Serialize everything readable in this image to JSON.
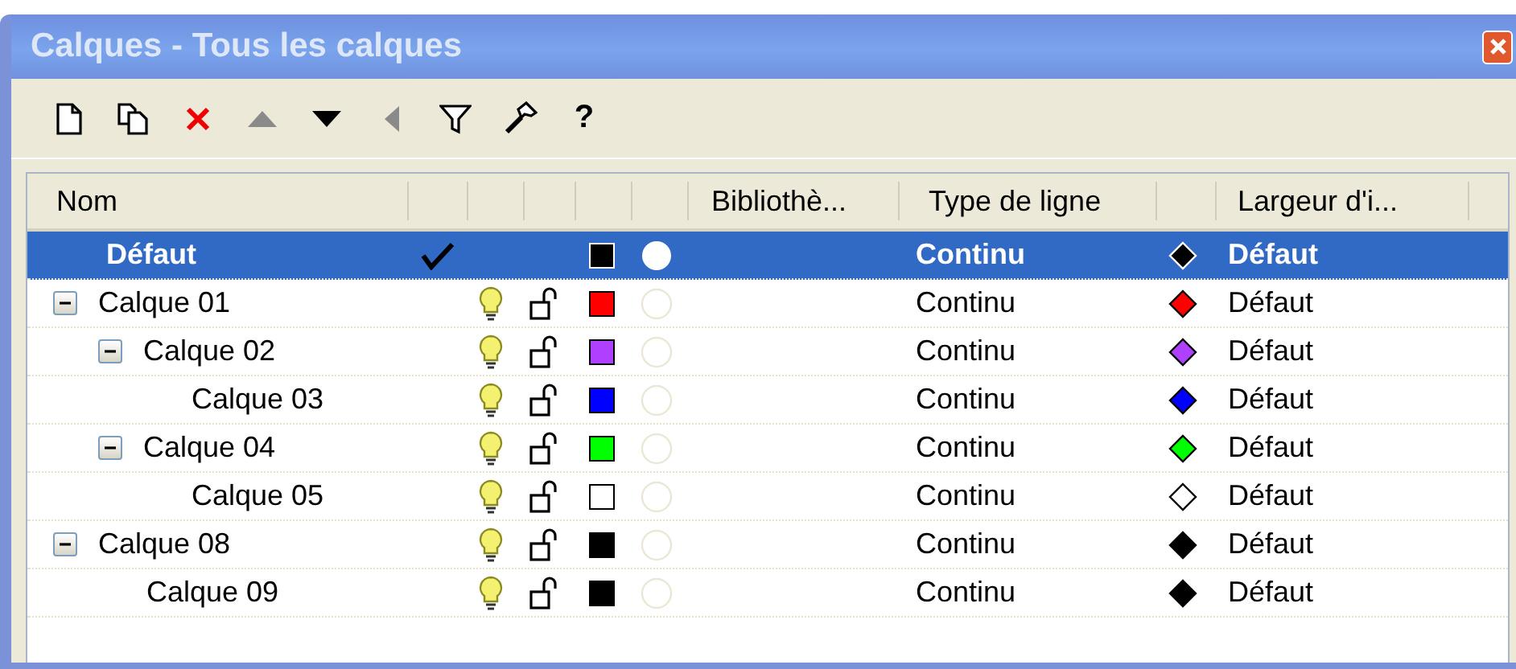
{
  "window": {
    "title": "Calques - Tous les calques"
  },
  "toolbar": [
    {
      "kind": "new",
      "disabled": false
    },
    {
      "kind": "copy",
      "disabled": false
    },
    {
      "kind": "delete",
      "disabled": false
    },
    {
      "kind": "up",
      "disabled": true
    },
    {
      "kind": "down",
      "disabled": false
    },
    {
      "kind": "left",
      "disabled": true
    },
    {
      "kind": "filter",
      "disabled": false
    },
    {
      "kind": "tools",
      "disabled": false
    },
    {
      "kind": "help",
      "label": "?",
      "disabled": false
    }
  ],
  "header": {
    "name": "Nom",
    "library": "Bibliothè...",
    "linetype": "Type de ligne",
    "lineweight": "Largeur d'i..."
  },
  "rows": [
    {
      "kind": "default",
      "name": "Défaut",
      "selected": true,
      "current": true,
      "color": "#000000",
      "linetype": "Continu",
      "lineweight": "Défaut"
    },
    {
      "kind": "layer",
      "name": "Calque 01",
      "selected": false,
      "current": false,
      "expanded": true,
      "visible": true,
      "locked": false,
      "color": "#ff0000",
      "linetype": "Continu",
      "lineweight": "Défaut",
      "children": [
        {
          "kind": "layer",
          "name": "Calque 02",
          "selected": false,
          "current": false,
          "expanded": true,
          "visible": true,
          "locked": false,
          "color": "#b040ff",
          "linetype": "Continu",
          "lineweight": "Défaut",
          "children": [
            {
              "kind": "layer",
              "name": "Calque 03",
              "selected": false,
              "current": false,
              "visible": true,
              "locked": false,
              "color": "#0000ff",
              "linetype": "Continu",
              "lineweight": "Défaut"
            }
          ]
        },
        {
          "kind": "layer",
          "name": "Calque 04",
          "selected": false,
          "current": false,
          "expanded": true,
          "visible": true,
          "locked": false,
          "color": "#00ff00",
          "linetype": "Continu",
          "lineweight": "Défaut",
          "children": [
            {
              "kind": "layer",
              "name": "Calque 05",
              "selected": false,
              "current": false,
              "visible": true,
              "locked": false,
              "color": "#ffffff",
              "linetype": "Continu",
              "lineweight": "Défaut"
            }
          ]
        }
      ]
    },
    {
      "kind": "layer",
      "name": "Calque 08",
      "selected": false,
      "current": false,
      "expanded": true,
      "visible": true,
      "locked": false,
      "color": "#000000",
      "linetype": "Continu",
      "lineweight": "Défaut",
      "children": [
        {
          "kind": "layer",
          "name": "Calque 09",
          "selected": false,
          "current": false,
          "visible": true,
          "locked": false,
          "color": "#000000",
          "linetype": "Continu",
          "lineweight": "Défaut"
        }
      ]
    }
  ]
}
